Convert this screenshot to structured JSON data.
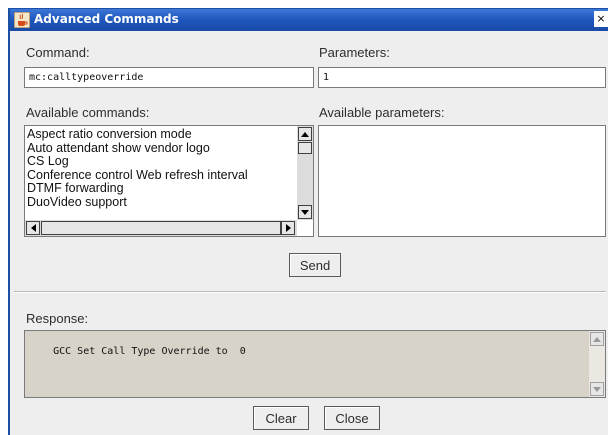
{
  "window": {
    "title": "Advanced Commands",
    "close_glyph": "×"
  },
  "command": {
    "label": "Command:",
    "value": "mc:calltypeoverride"
  },
  "parameters": {
    "label": "Parameters:",
    "value": "1"
  },
  "available_commands": {
    "label": "Available commands:",
    "items": [
      "Aspect ratio conversion mode",
      "Auto attendant show vendor logo",
      "CS Log",
      "Conference control Web refresh interval",
      "DTMF forwarding",
      "DuoVideo support"
    ]
  },
  "available_parameters": {
    "label": "Available parameters:"
  },
  "send_button": "Send",
  "response": {
    "label": "Response:",
    "text": "GCC Set Call Type Override to  0"
  },
  "footer": {
    "clear_label": "Clear",
    "close_label": "Close"
  },
  "icons": {
    "app_icon": "java-cup-icon",
    "close_icon": "close-icon"
  },
  "colors": {
    "titlebar": "#1e57bd",
    "dialog_bg": "#eeeeee",
    "response_bg": "#d8d3c8"
  }
}
